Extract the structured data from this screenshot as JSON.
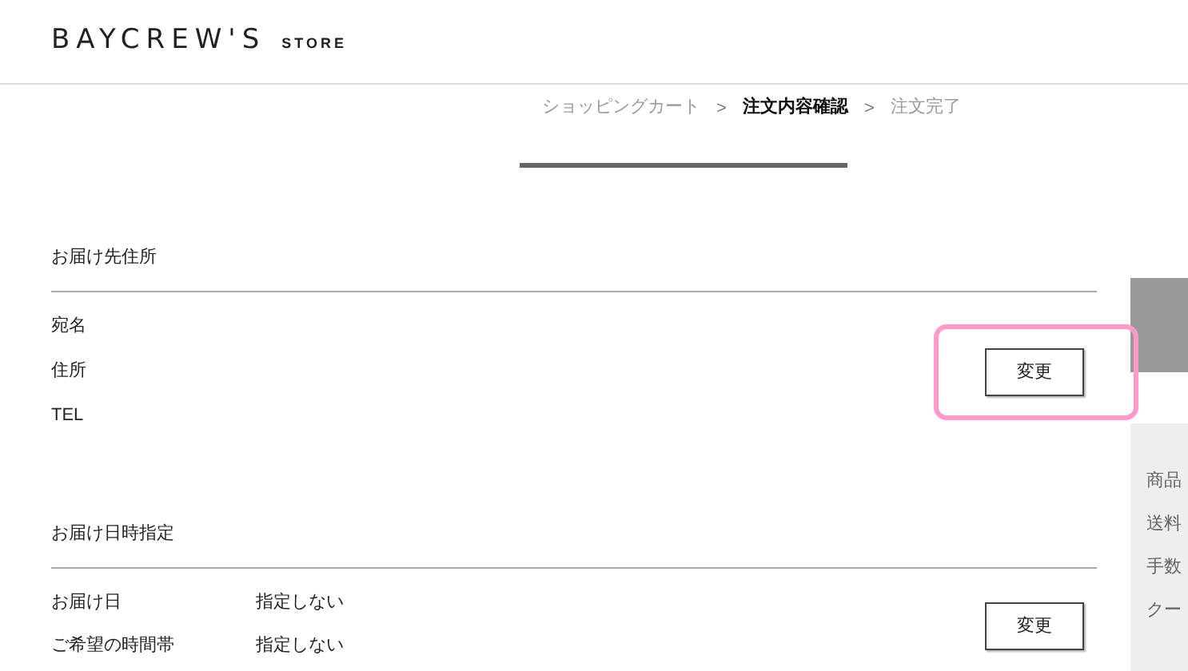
{
  "logo": {
    "brand": "BAYCREW'S",
    "sub": "STORE"
  },
  "steps": [
    {
      "label": "ショッピングカート",
      "selected": false,
      "reached": true
    },
    {
      "label": "注文内容確認",
      "selected": true,
      "reached": true
    },
    {
      "label": "注文完了",
      "selected": false,
      "reached": false
    }
  ],
  "step_separator": ">",
  "sections": [
    {
      "title": "お届け先住所",
      "rows": [
        {
          "label": "宛名"
        },
        {
          "label": "住所"
        },
        {
          "label": "TEL"
        }
      ],
      "button": "変更",
      "highlighted": true
    },
    {
      "title": "お届け日時指定",
      "rows": [
        {
          "label": "お届け日",
          "value": "指定しない"
        },
        {
          "label": "ご希望の時間帯",
          "value": "指定しない"
        }
      ],
      "button": "変更",
      "highlighted": false
    }
  ],
  "summary": {
    "rows": [
      "商品",
      "送料",
      "手数",
      "クー"
    ]
  }
}
